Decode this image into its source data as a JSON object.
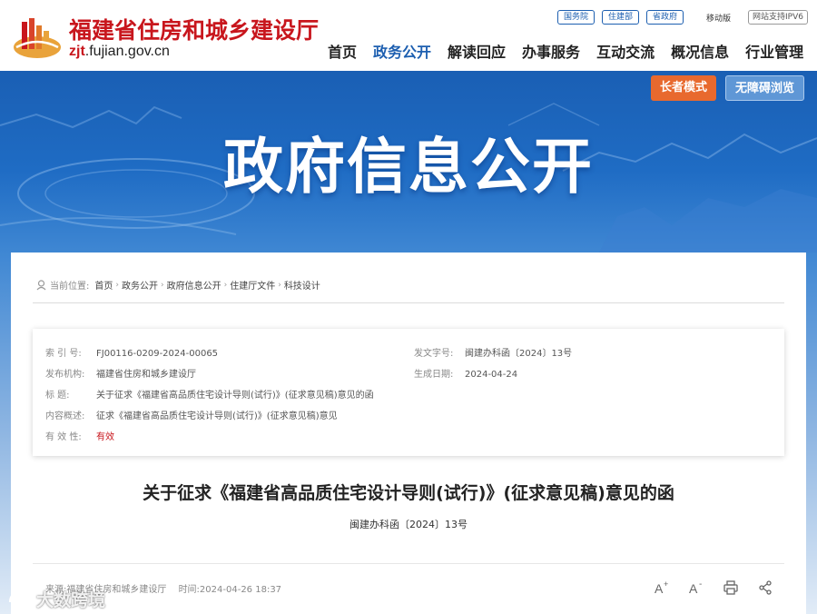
{
  "header": {
    "site_name": "福建省住房和城乡建设厅",
    "domain_prefix": "zjt",
    "domain_rest": ".fujian.gov.cn",
    "top_links": [
      "国务院",
      "住建部",
      "省政府"
    ],
    "mobile_label": "移动版",
    "ipv6_label": "网站支持IPV6"
  },
  "nav": {
    "items": [
      "首页",
      "政务公开",
      "解读回应",
      "办事服务",
      "互动交流",
      "概况信息",
      "行业管理"
    ],
    "active_index": 1
  },
  "banner": {
    "title": "政府信息公开",
    "elder_mode": "长者模式",
    "accessible": "无障碍浏览"
  },
  "breadcrumb": {
    "prefix": "当前位置:",
    "items": [
      "首页",
      "政务公开",
      "政府信息公开",
      "住建厅文件",
      "科技设计"
    ]
  },
  "meta": {
    "index_label": "索 引 号:",
    "index_value": "FJ00116-0209-2024-00065",
    "doc_no_label": "发文字号:",
    "doc_no_value": "闽建办科函〔2024〕13号",
    "publisher_label": "发布机构:",
    "publisher_value": "福建省住房和城乡建设厅",
    "date_label": "生成日期:",
    "date_value": "2024-04-24",
    "title_label": "标    题:",
    "title_value": "关于征求《福建省高品质住宅设计导则(试行)》(征求意见稿)意见的函",
    "summary_label": "内容概述:",
    "summary_value": "征求《福建省高品质住宅设计导则(试行)》(征求意见稿)意见",
    "validity_label": "有 效 性:",
    "validity_value": "有效"
  },
  "document": {
    "title": "关于征求《福建省高品质住宅设计导则(试行)》(征求意见稿)意见的函",
    "number": "闽建办科函〔2024〕13号",
    "source": "来源:福建省住房和城乡建设厅",
    "time": "时间:2024-04-26 18:37"
  },
  "watermark": {
    "text": "大数跨境"
  },
  "colors": {
    "brand_red": "#c8161d",
    "brand_blue": "#1d5fb0",
    "elder_orange": "#e8692e"
  }
}
